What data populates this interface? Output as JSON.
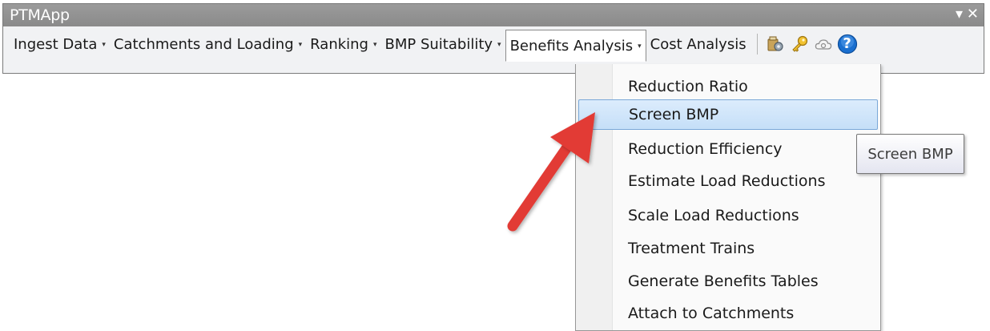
{
  "window": {
    "title": "PTMApp",
    "dropdown_glyph": "▾",
    "close_glyph": "✕"
  },
  "menubar": {
    "items": [
      {
        "label": "Ingest Data",
        "has_arrow": true
      },
      {
        "label": "Catchments and Loading",
        "has_arrow": true
      },
      {
        "label": "Ranking",
        "has_arrow": true
      },
      {
        "label": "BMP Suitability",
        "has_arrow": true
      },
      {
        "label": "Benefits Analysis",
        "has_arrow": true,
        "active": true
      },
      {
        "label": "Cost Analysis",
        "has_arrow": false
      }
    ],
    "arrow_glyph": "▾",
    "icons": [
      "tools-icon",
      "key-icon",
      "cloud-icon",
      "help-icon"
    ],
    "help_glyph": "?"
  },
  "dropdown": {
    "items": [
      {
        "label": "Reduction Ratio"
      },
      {
        "label": "Screen BMP",
        "highlighted": true
      },
      {
        "label": "Reduction Efficiency"
      },
      {
        "label": "Estimate Load Reductions"
      },
      {
        "label": "Scale Load Reductions"
      },
      {
        "label": "Treatment Trains"
      },
      {
        "label": "Generate Benefits Tables"
      },
      {
        "label": "Attach to Catchments"
      }
    ]
  },
  "tooltip": {
    "text": "Screen BMP"
  },
  "colors": {
    "annotation_arrow": "#e23b36",
    "highlight": "#c5dff8",
    "help_icon": "#1a6fcf"
  }
}
